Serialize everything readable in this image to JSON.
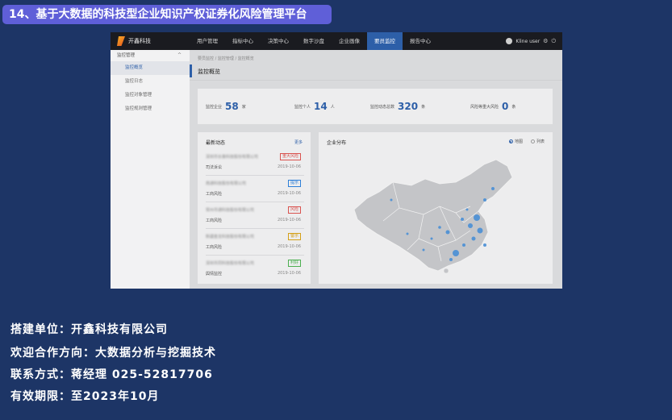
{
  "title": "14、基于大数据的科技型企业知识产权证券化风险管理平台",
  "app": {
    "logo_text": "开鑫科技",
    "nav": [
      "用户管理",
      "指标中心",
      "决策中心",
      "数字沙盘",
      "企业画像",
      "要员监控",
      "报告中心"
    ],
    "nav_active_index": 5,
    "user_name": "Kline user"
  },
  "sidebar": {
    "group_label": "监控管理",
    "items": [
      {
        "label": "监控概览",
        "active": true
      },
      {
        "label": "监控日志",
        "active": false
      },
      {
        "label": "监控对象管理",
        "active": false
      },
      {
        "label": "监控规则管理",
        "active": false
      }
    ]
  },
  "breadcrumb": "要员监控 / 监控管理 / 监控概览",
  "page_title": "监控概览",
  "stats": [
    {
      "label": "监控企业",
      "value": "58",
      "unit": "家"
    },
    {
      "label": "监控个人",
      "value": "14",
      "unit": "人"
    },
    {
      "label": "监控动态总数",
      "value": "320",
      "unit": "条"
    },
    {
      "label": "风险等重大风险",
      "value": "0",
      "unit": "条"
    }
  ],
  "news": {
    "title": "最新动态",
    "more": "更多",
    "items": [
      {
        "company": "深圳市长泰科技股份有限公司",
        "tag": "重大风险",
        "tag_color": "#d9534f",
        "type": "司法诉讼",
        "date": "2019-10-06"
      },
      {
        "company": "南通科技股份有限公司",
        "tag": "提示",
        "tag_color": "#2d7fd8",
        "type": "工商风险",
        "date": "2019-10-06"
      },
      {
        "company": "常州市通科技股份有限公司",
        "tag": "风险",
        "tag_color": "#d9534f",
        "type": "工商风险",
        "date": "2019-10-06"
      },
      {
        "company": "新疆金龙科技股份有限公司",
        "tag": "警示",
        "tag_color": "#d4a017",
        "type": "工商风险",
        "date": "2019-10-06"
      },
      {
        "company": "深圳市同科技股份有限公司",
        "tag": "利好",
        "tag_color": "#4caf50",
        "type": "舆情监控",
        "date": "2019-10-06"
      }
    ]
  },
  "map": {
    "title": "企业分布",
    "options": [
      {
        "label": "地图",
        "selected": true
      },
      {
        "label": "列表",
        "selected": false
      }
    ],
    "colors": {
      "land": "#c4c5c8",
      "border": "#f2f2f2",
      "dot": "#4a8fd6"
    }
  },
  "info": {
    "org": "搭建单位：开鑫科技有限公司",
    "direction": "欢迎合作方向：大数据分析与挖掘技术",
    "contact": "联系方式：蒋经理 025-52817706",
    "valid": "有效期限：至2023年10月"
  }
}
